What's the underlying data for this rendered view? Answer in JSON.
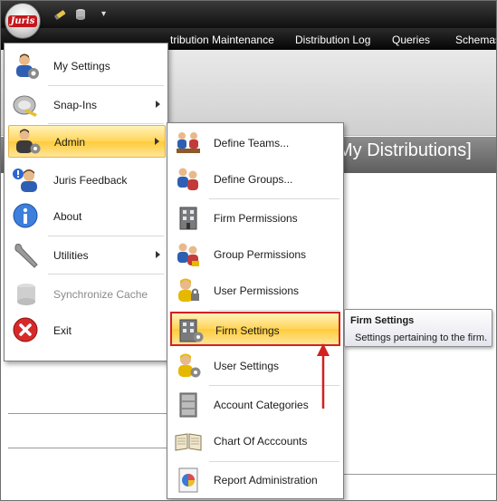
{
  "titlebar": {
    "orb_logo": "Juris",
    "qat_more": "▾"
  },
  "menubar": {
    "items": [
      "tribution Maintenance",
      "Distribution Log",
      "Queries",
      "Schemas"
    ]
  },
  "document": {
    "title": "My Distributions]"
  },
  "app_menu": {
    "items": [
      {
        "label": "My Settings",
        "icon": "user-gear-icon"
      },
      {
        "label": "Snap-Ins",
        "icon": "snap-ins-icon",
        "has_submenu": true
      },
      {
        "label": "Admin",
        "icon": "admin-icon",
        "has_submenu": true,
        "active": true
      },
      {
        "label": "Juris Feedback",
        "icon": "feedback-icon"
      },
      {
        "label": "About",
        "icon": "info-icon"
      },
      {
        "label": "Utilities",
        "icon": "wrench-icon",
        "has_submenu": true
      },
      {
        "label": "Synchronize Cache",
        "icon": "database-icon",
        "disabled": true
      },
      {
        "label": "Exit",
        "icon": "exit-icon"
      }
    ]
  },
  "admin_submenu": {
    "items": [
      {
        "label": "Define Teams...",
        "icon": "teams-icon"
      },
      {
        "label": "Define Groups...",
        "icon": "groups-icon"
      },
      {
        "label": "Firm Permissions",
        "icon": "building-icon"
      },
      {
        "label": "Group Permissions",
        "icon": "group-permissions-icon"
      },
      {
        "label": "User Permissions",
        "icon": "user-lock-icon"
      },
      {
        "label": "Firm Settings",
        "icon": "building-settings-icon",
        "active": true
      },
      {
        "label": "User Settings",
        "icon": "user-settings-icon"
      },
      {
        "label": "Account Categories",
        "icon": "cabinet-icon"
      },
      {
        "label": "Chart Of Acccounts",
        "icon": "book-icon"
      },
      {
        "label": "Report Administration",
        "icon": "report-icon"
      }
    ]
  },
  "tooltip": {
    "title": "Firm Settings",
    "text": "Settings pertaining to the firm."
  },
  "colors": {
    "highlight": "#ffd55a",
    "annotation": "#d32020",
    "menubar": "#1a1a1a"
  }
}
